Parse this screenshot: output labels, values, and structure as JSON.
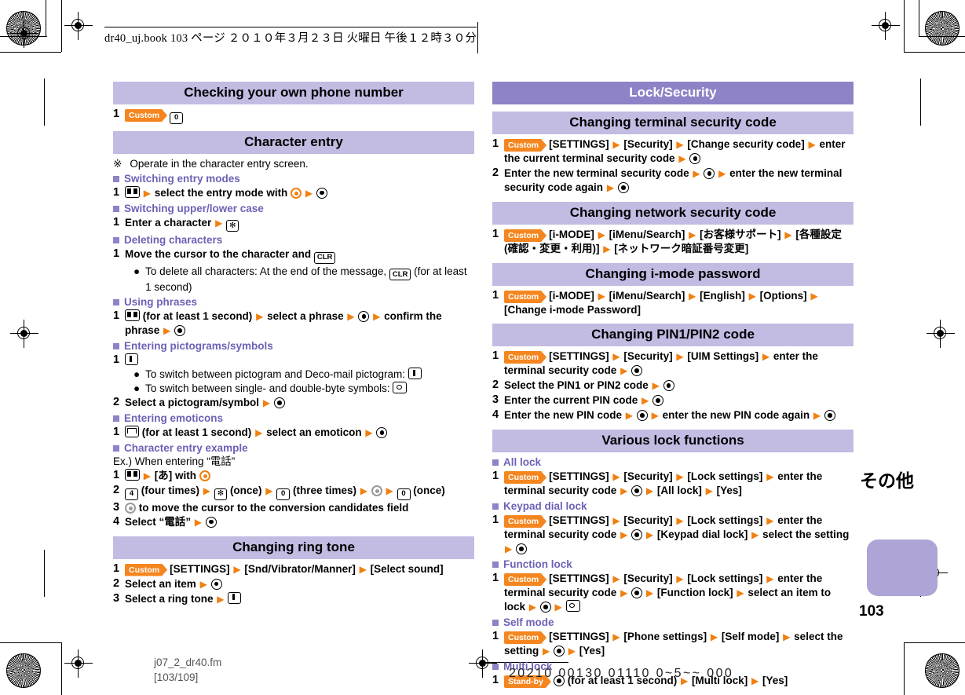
{
  "meta": {
    "running_head": "dr40_uj.book   103 ページ   ２０１０年３月２３日   火曜日   午後１２時３０分",
    "footer_file": "j07_2_dr40.fm",
    "footer_pages": "[103/109]",
    "footer_code": "20210 00130 01110 0~5~~ 000",
    "page_number": "103",
    "tab_label": "その他"
  },
  "colors": {
    "banner_purple": "#8d83c6",
    "section_purple": "#c2bbe2",
    "subhead_purple": "#6b62b5",
    "accent_orange": "#f08010",
    "badge_orange": "#f5861f",
    "tab_purple": "#aea4d6"
  },
  "badges": {
    "custom": "Custom",
    "standby": "Stand-by"
  },
  "left": {
    "sections": [
      {
        "title": "Checking your own phone number",
        "style": "section",
        "steps": [
          {
            "num": "1",
            "parts": [
              "badge:Custom",
              "key:0"
            ]
          }
        ]
      },
      {
        "title": "Character entry",
        "style": "section",
        "kome": {
          "mark": "※",
          "text": "Operate in the character entry screen."
        },
        "groups": [
          {
            "subhead": "Switching entry modes",
            "steps": [
              {
                "num": "1",
                "text": "select the entry mode with"
              }
            ]
          },
          {
            "subhead": "Switching upper/lower case",
            "steps": [
              {
                "num": "1",
                "text": "Enter a character"
              }
            ]
          },
          {
            "subhead": "Deleting characters",
            "steps": [
              {
                "num": "1",
                "text": "Move the cursor to the character and"
              }
            ],
            "notes": [
              "To delete all characters: At the end of the message,",
              "(for at least 1 second)"
            ]
          },
          {
            "subhead": "Using phrases",
            "steps": [
              {
                "num": "1",
                "text_a": "(for at least 1 second)",
                "text_b": "select a phrase",
                "text_c": "confirm the phrase"
              }
            ]
          },
          {
            "subhead": "Entering pictograms/symbols",
            "steps": [
              {
                "num": "1",
                "text": ""
              },
              {
                "num": "2",
                "text": "Select a pictogram/symbol"
              }
            ],
            "notes": [
              "To switch between pictogram and Deco-mail pictogram:",
              "To switch between single- and double-byte symbols:"
            ]
          },
          {
            "subhead": "Entering emoticons",
            "steps": [
              {
                "num": "1",
                "text_a": "(for at least 1 second)",
                "text_b": "select an emoticon"
              }
            ]
          },
          {
            "subhead": "Character entry example",
            "example_intro": "Ex.) When entering “電話”",
            "steps": [
              {
                "num": "1",
                "text": "[あ] with"
              },
              {
                "num": "2",
                "t1": "(four times)",
                "t2": "(once)",
                "t3": "(three times)",
                "t4": "(once)"
              },
              {
                "num": "3",
                "text": "to move the cursor to the conversion candidates field"
              },
              {
                "num": "4",
                "text": "Select “電話”"
              }
            ]
          }
        ]
      },
      {
        "title": "Changing ring tone",
        "style": "section",
        "steps": [
          {
            "num": "1",
            "items": [
              "[SETTINGS]",
              "[Snd/Vibrator/Manner]",
              "[Select sound]"
            ]
          },
          {
            "num": "2",
            "text": "Select an item"
          },
          {
            "num": "3",
            "text": "Select a ring tone"
          }
        ]
      }
    ]
  },
  "right": {
    "banner": "Lock/Security",
    "sections": [
      {
        "title": "Changing terminal security code",
        "steps": [
          {
            "num": "1",
            "items": [
              "[SETTINGS]",
              "[Security]",
              "[Change security code]",
              "enter the current terminal security code"
            ]
          },
          {
            "num": "2",
            "text_a": "Enter the new terminal security code",
            "text_b": "enter the new terminal security code again"
          }
        ]
      },
      {
        "title": "Changing network security code",
        "steps": [
          {
            "num": "1",
            "items": [
              "[i-MODE]",
              "[iMenu/Search]",
              "[お客様サポート]",
              "[各種設定 (確認・変更・利用)]",
              "[ネットワーク暗証番号変更]"
            ]
          }
        ]
      },
      {
        "title": "Changing i-mode password",
        "steps": [
          {
            "num": "1",
            "items": [
              "[i-MODE]",
              "[iMenu/Search]",
              "[English]",
              "[Options]",
              "[Change i-mode Password]"
            ]
          }
        ]
      },
      {
        "title": "Changing PIN1/PIN2 code",
        "steps": [
          {
            "num": "1",
            "items": [
              "[SETTINGS]",
              "[Security]",
              "[UIM Settings]",
              "enter the terminal security code"
            ]
          },
          {
            "num": "2",
            "text": "Select the PIN1 or PIN2 code"
          },
          {
            "num": "3",
            "text": "Enter the current PIN code"
          },
          {
            "num": "4",
            "text_a": "Enter the new PIN code",
            "text_b": "enter the new PIN code again"
          }
        ]
      },
      {
        "title": "Various lock functions",
        "groups": [
          {
            "subhead": "All lock",
            "step_num": "1",
            "items": [
              "[SETTINGS]",
              "[Security]",
              "[Lock settings]",
              "enter the terminal security code",
              "[All lock]",
              "[Yes]"
            ]
          },
          {
            "subhead": "Keypad dial lock",
            "step_num": "1",
            "items": [
              "[SETTINGS]",
              "[Security]",
              "[Lock settings]",
              "enter the terminal security code",
              "[Keypad dial lock]",
              "select the setting"
            ]
          },
          {
            "subhead": "Function lock",
            "step_num": "1",
            "items": [
              "[SETTINGS]",
              "[Security]",
              "[Lock settings]",
              "enter the terminal security code",
              "[Function lock]",
              "select an item to lock"
            ]
          },
          {
            "subhead": "Self mode",
            "step_num": "1",
            "items": [
              "[SETTINGS]",
              "[Phone settings]",
              "[Self mode]",
              "select the setting",
              "[Yes]"
            ]
          },
          {
            "subhead": "Multi lock",
            "step_num": "1",
            "items": [
              "(for at least 1 second)",
              "[Multi lock]",
              "[Yes]"
            ]
          }
        ]
      }
    ]
  },
  "keys": {
    "zero": "0",
    "four": "4",
    "clr": "CLR",
    "star": "✻"
  }
}
